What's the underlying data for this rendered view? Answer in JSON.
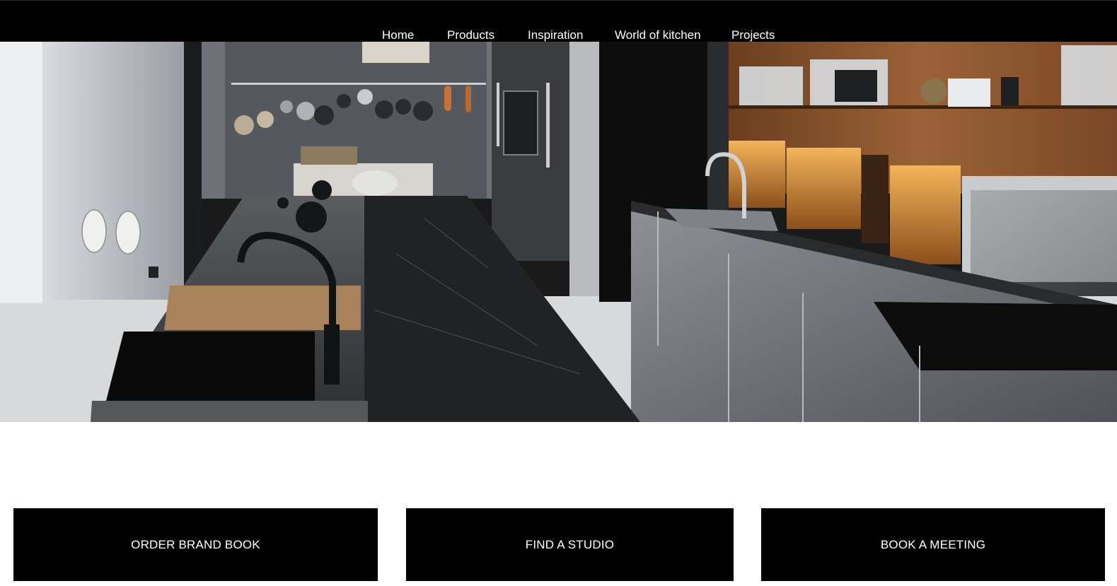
{
  "nav": {
    "items": [
      {
        "label": "Home"
      },
      {
        "label": "Products"
      },
      {
        "label": "Inspiration"
      },
      {
        "label": "World of kitchen"
      },
      {
        "label": "Projects"
      }
    ]
  },
  "hero": {
    "subject": "kitchen-photo"
  },
  "cta": {
    "order": "ORDER BRAND BOOK",
    "studio": "FIND A STUDIO",
    "meeting": "BOOK A MEETING"
  },
  "colors": {
    "nav_background": "#000000",
    "button_background": "#000000",
    "text_on_dark": "#ffffff",
    "page_background": "#ffffff"
  }
}
